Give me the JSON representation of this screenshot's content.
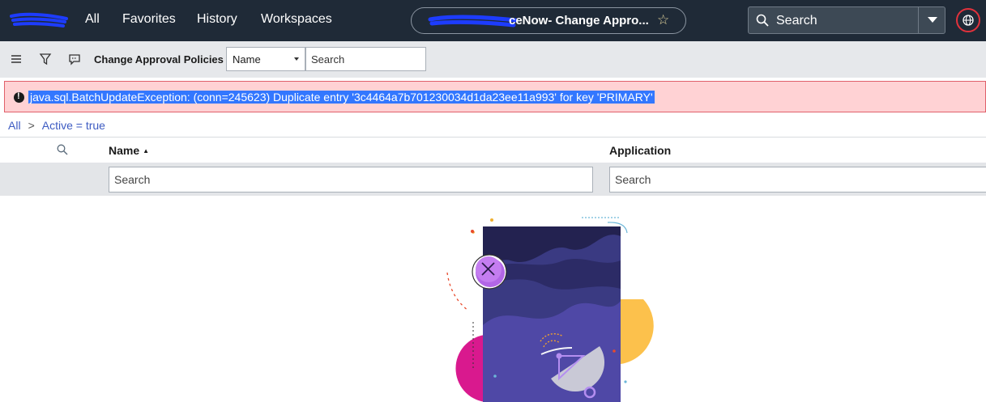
{
  "topnav": {
    "items": [
      "All",
      "Favorites",
      "History",
      "Workspaces"
    ],
    "page_title": "ceNow- Change Appro...",
    "search_placeholder": "Search"
  },
  "listbar": {
    "title": "Change Approval Policies",
    "field_select": "Name",
    "search_placeholder": "Search"
  },
  "error": {
    "message": "java.sql.BatchUpdateException: (conn=245623) Duplicate entry '3c4464a7b701230034d1da23ee11a993' for key 'PRIMARY'"
  },
  "breadcrumb": {
    "root": "All",
    "separator": ">",
    "filter": "Active = true"
  },
  "columns": {
    "name": "Name",
    "application": "Application",
    "name_search_placeholder": "Search",
    "application_search_placeholder": "Search"
  },
  "colors": {
    "nav_bg": "#1f2a37",
    "error_bg": "#ffd2d4",
    "error_border": "#e0606a",
    "link": "#3d5bc2",
    "selection": "#3377ff"
  }
}
